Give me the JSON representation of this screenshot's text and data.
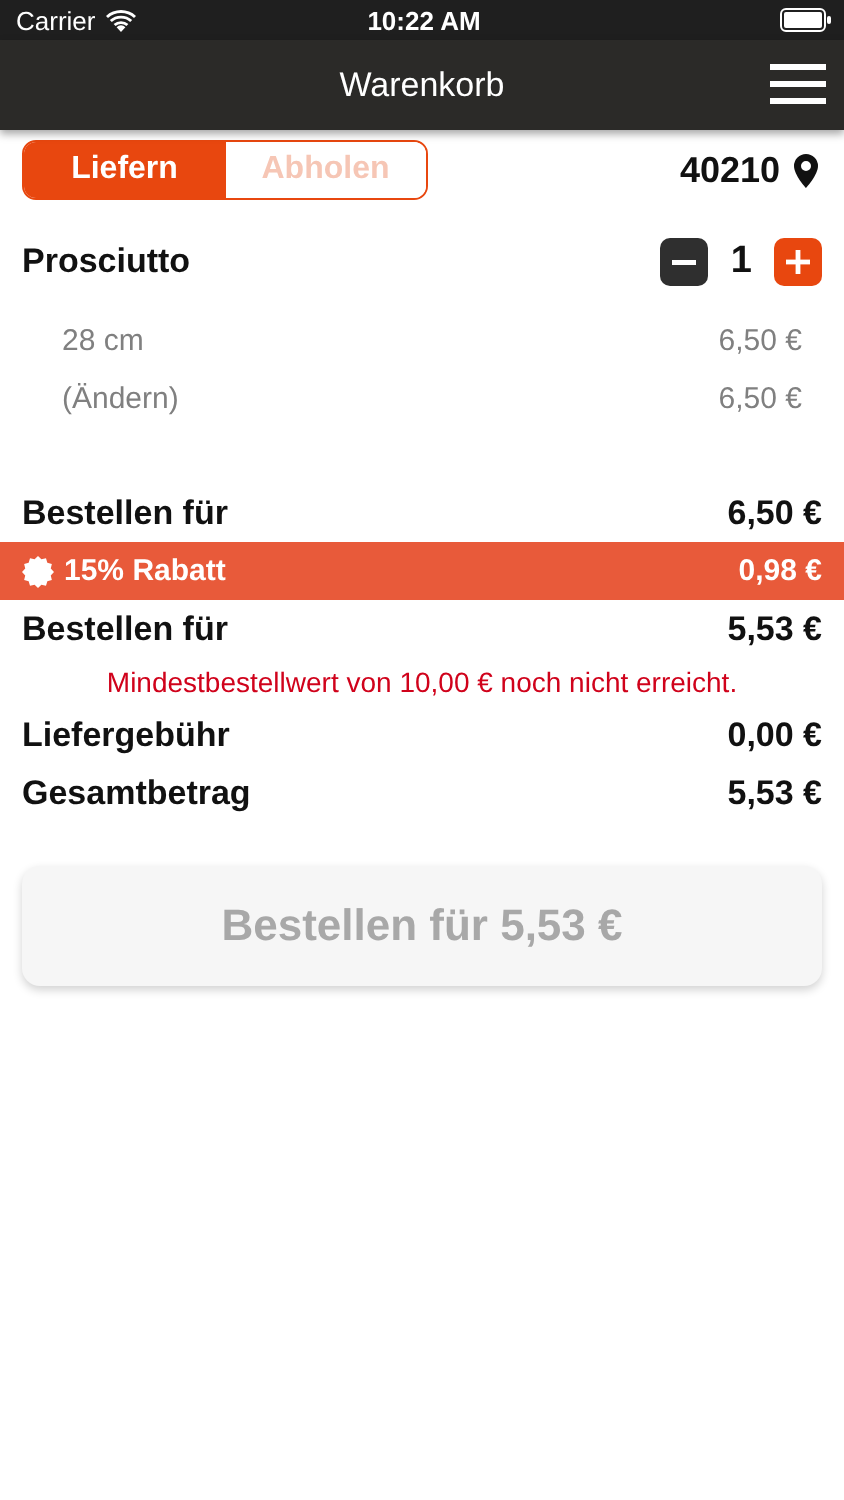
{
  "status_bar": {
    "carrier": "Carrier",
    "time": "10:22 AM"
  },
  "nav_bar": {
    "title": "Warenkorb"
  },
  "delivery_tabs": [
    {
      "label": "Liefern",
      "selected": true
    },
    {
      "label": "Abholen",
      "selected": false
    }
  ],
  "postcode": "40210",
  "items": [
    {
      "name": "Prosciutto",
      "quantity": "1",
      "options": [
        {
          "label": "28 cm",
          "price": "6,50 €"
        },
        {
          "label": "(Ändern)",
          "price": "6,50 €"
        }
      ]
    }
  ],
  "summary": [
    {
      "kind": "line",
      "label": "Bestellen für",
      "value": "6,50 €"
    },
    {
      "kind": "discount",
      "label": "15% Rabatt",
      "value": "0,98 €"
    },
    {
      "kind": "line",
      "label": "Bestellen für",
      "value": "5,53 €"
    },
    {
      "kind": "notice",
      "text": "Mindestbestellwert von 10,00 € noch nicht erreicht."
    },
    {
      "kind": "line",
      "label": "Liefergebühr",
      "value": "0,00 €"
    },
    {
      "kind": "line",
      "label": "Gesamtbetrag",
      "value": "5,53 €"
    }
  ],
  "order_button": {
    "label": "Bestellen für 5,53 €",
    "disabled": true
  }
}
